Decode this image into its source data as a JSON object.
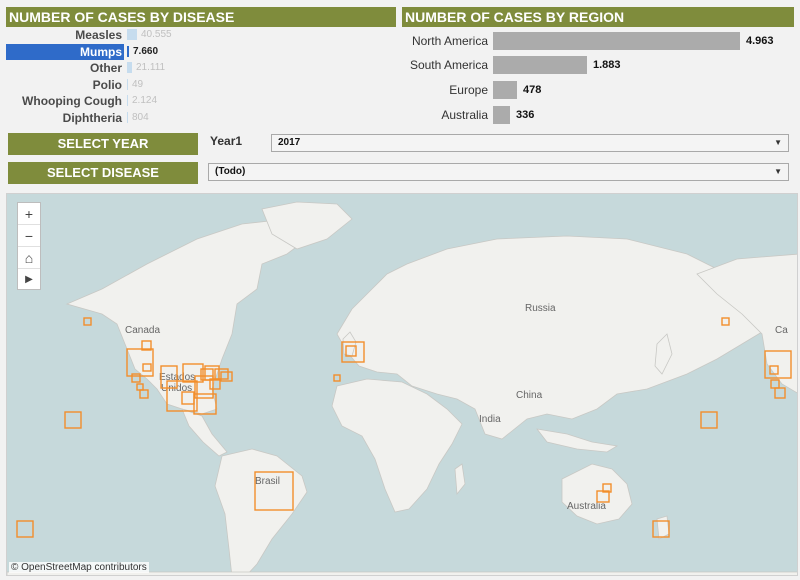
{
  "headers": {
    "disease": "NUMBER OF CASES BY DISEASE",
    "region": "NUMBER OF CASES BY REGION"
  },
  "diseases": [
    {
      "name": "Measles",
      "value_text": "40.555",
      "value": 40555,
      "selected": false
    },
    {
      "name": "Mumps",
      "value_text": "7.660",
      "value": 7660,
      "selected": true
    },
    {
      "name": "Other",
      "value_text": "21.111",
      "value": 21111,
      "selected": false
    },
    {
      "name": "Polio",
      "value_text": "49",
      "value": 49,
      "selected": false
    },
    {
      "name": "Whooping Cough",
      "value_text": "2.124",
      "value": 2124,
      "selected": false
    },
    {
      "name": "Diphtheria",
      "value_text": "804",
      "value": 804,
      "selected": false
    }
  ],
  "regions": [
    {
      "name": "North America",
      "value_text": "4.963",
      "value": 4963
    },
    {
      "name": "South America",
      "value_text": "1.883",
      "value": 1883
    },
    {
      "name": "Europe",
      "value_text": "478",
      "value": 478
    },
    {
      "name": "Australia",
      "value_text": "336",
      "value": 336
    }
  ],
  "controls": {
    "select_year_label": "SELECT YEAR",
    "year_field_label": "Year1",
    "year_value": "2017",
    "select_disease_label": "SELECT DISEASE",
    "disease_value": "(Todo)"
  },
  "map": {
    "attribution": "© OpenStreetMap contributors",
    "zoom_in": "+",
    "zoom_out": "−",
    "home_icon": "home-icon",
    "pan_icon": "play-icon",
    "marker_color": "#f28e2b",
    "labels": {
      "canada_left": "Canada",
      "canada_right": "Ca",
      "usa_line1": "Estados",
      "usa_line2": "Unidos",
      "russia": "Russia",
      "china": "China",
      "india": "India",
      "brasil": "Brasil",
      "australia": "Australia"
    }
  },
  "colors": {
    "header_bg": "#7f8c3c",
    "selected_bar": "#2f6bc9",
    "region_bar": "#ababab"
  }
}
